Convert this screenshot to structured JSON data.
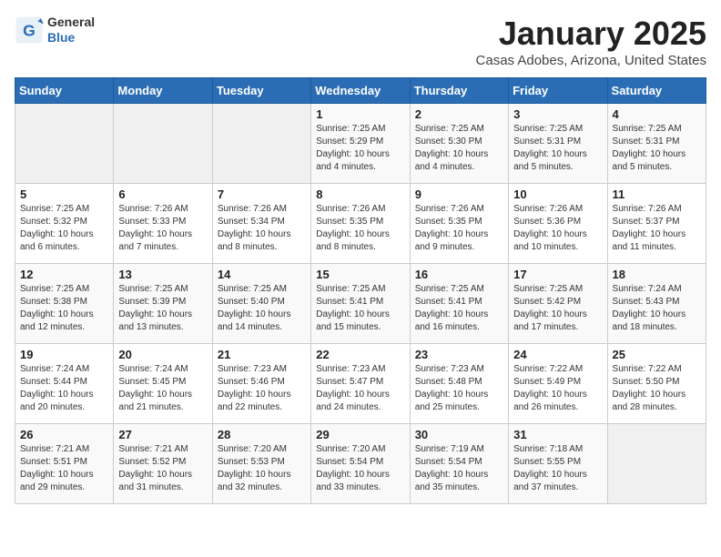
{
  "header": {
    "logo_general": "General",
    "logo_blue": "Blue",
    "title": "January 2025",
    "subtitle": "Casas Adobes, Arizona, United States"
  },
  "weekdays": [
    "Sunday",
    "Monday",
    "Tuesday",
    "Wednesday",
    "Thursday",
    "Friday",
    "Saturday"
  ],
  "weeks": [
    [
      {
        "day": "",
        "info": ""
      },
      {
        "day": "",
        "info": ""
      },
      {
        "day": "",
        "info": ""
      },
      {
        "day": "1",
        "info": "Sunrise: 7:25 AM\nSunset: 5:29 PM\nDaylight: 10 hours\nand 4 minutes."
      },
      {
        "day": "2",
        "info": "Sunrise: 7:25 AM\nSunset: 5:30 PM\nDaylight: 10 hours\nand 4 minutes."
      },
      {
        "day": "3",
        "info": "Sunrise: 7:25 AM\nSunset: 5:31 PM\nDaylight: 10 hours\nand 5 minutes."
      },
      {
        "day": "4",
        "info": "Sunrise: 7:25 AM\nSunset: 5:31 PM\nDaylight: 10 hours\nand 5 minutes."
      }
    ],
    [
      {
        "day": "5",
        "info": "Sunrise: 7:25 AM\nSunset: 5:32 PM\nDaylight: 10 hours\nand 6 minutes."
      },
      {
        "day": "6",
        "info": "Sunrise: 7:26 AM\nSunset: 5:33 PM\nDaylight: 10 hours\nand 7 minutes."
      },
      {
        "day": "7",
        "info": "Sunrise: 7:26 AM\nSunset: 5:34 PM\nDaylight: 10 hours\nand 8 minutes."
      },
      {
        "day": "8",
        "info": "Sunrise: 7:26 AM\nSunset: 5:35 PM\nDaylight: 10 hours\nand 8 minutes."
      },
      {
        "day": "9",
        "info": "Sunrise: 7:26 AM\nSunset: 5:35 PM\nDaylight: 10 hours\nand 9 minutes."
      },
      {
        "day": "10",
        "info": "Sunrise: 7:26 AM\nSunset: 5:36 PM\nDaylight: 10 hours\nand 10 minutes."
      },
      {
        "day": "11",
        "info": "Sunrise: 7:26 AM\nSunset: 5:37 PM\nDaylight: 10 hours\nand 11 minutes."
      }
    ],
    [
      {
        "day": "12",
        "info": "Sunrise: 7:25 AM\nSunset: 5:38 PM\nDaylight: 10 hours\nand 12 minutes."
      },
      {
        "day": "13",
        "info": "Sunrise: 7:25 AM\nSunset: 5:39 PM\nDaylight: 10 hours\nand 13 minutes."
      },
      {
        "day": "14",
        "info": "Sunrise: 7:25 AM\nSunset: 5:40 PM\nDaylight: 10 hours\nand 14 minutes."
      },
      {
        "day": "15",
        "info": "Sunrise: 7:25 AM\nSunset: 5:41 PM\nDaylight: 10 hours\nand 15 minutes."
      },
      {
        "day": "16",
        "info": "Sunrise: 7:25 AM\nSunset: 5:41 PM\nDaylight: 10 hours\nand 16 minutes."
      },
      {
        "day": "17",
        "info": "Sunrise: 7:25 AM\nSunset: 5:42 PM\nDaylight: 10 hours\nand 17 minutes."
      },
      {
        "day": "18",
        "info": "Sunrise: 7:24 AM\nSunset: 5:43 PM\nDaylight: 10 hours\nand 18 minutes."
      }
    ],
    [
      {
        "day": "19",
        "info": "Sunrise: 7:24 AM\nSunset: 5:44 PM\nDaylight: 10 hours\nand 20 minutes."
      },
      {
        "day": "20",
        "info": "Sunrise: 7:24 AM\nSunset: 5:45 PM\nDaylight: 10 hours\nand 21 minutes."
      },
      {
        "day": "21",
        "info": "Sunrise: 7:23 AM\nSunset: 5:46 PM\nDaylight: 10 hours\nand 22 minutes."
      },
      {
        "day": "22",
        "info": "Sunrise: 7:23 AM\nSunset: 5:47 PM\nDaylight: 10 hours\nand 24 minutes."
      },
      {
        "day": "23",
        "info": "Sunrise: 7:23 AM\nSunset: 5:48 PM\nDaylight: 10 hours\nand 25 minutes."
      },
      {
        "day": "24",
        "info": "Sunrise: 7:22 AM\nSunset: 5:49 PM\nDaylight: 10 hours\nand 26 minutes."
      },
      {
        "day": "25",
        "info": "Sunrise: 7:22 AM\nSunset: 5:50 PM\nDaylight: 10 hours\nand 28 minutes."
      }
    ],
    [
      {
        "day": "26",
        "info": "Sunrise: 7:21 AM\nSunset: 5:51 PM\nDaylight: 10 hours\nand 29 minutes."
      },
      {
        "day": "27",
        "info": "Sunrise: 7:21 AM\nSunset: 5:52 PM\nDaylight: 10 hours\nand 31 minutes."
      },
      {
        "day": "28",
        "info": "Sunrise: 7:20 AM\nSunset: 5:53 PM\nDaylight: 10 hours\nand 32 minutes."
      },
      {
        "day": "29",
        "info": "Sunrise: 7:20 AM\nSunset: 5:54 PM\nDaylight: 10 hours\nand 33 minutes."
      },
      {
        "day": "30",
        "info": "Sunrise: 7:19 AM\nSunset: 5:54 PM\nDaylight: 10 hours\nand 35 minutes."
      },
      {
        "day": "31",
        "info": "Sunrise: 7:18 AM\nSunset: 5:55 PM\nDaylight: 10 hours\nand 37 minutes."
      },
      {
        "day": "",
        "info": ""
      }
    ]
  ]
}
